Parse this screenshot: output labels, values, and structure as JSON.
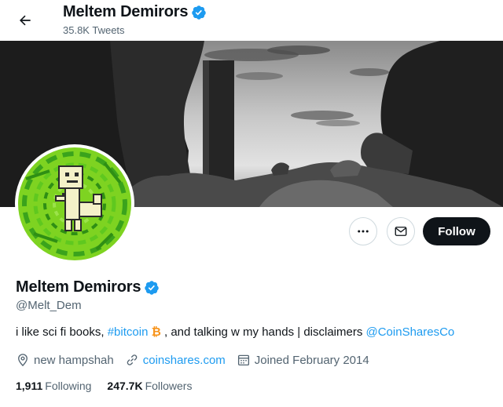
{
  "header": {
    "name": "Meltem Demirors",
    "tweet_count": "35.8K Tweets"
  },
  "icons": {
    "back": "arrow-left-icon",
    "verified": "verified-badge-icon",
    "more": "more-dots-icon",
    "message": "envelope-icon",
    "location": "location-pin-icon",
    "link": "link-icon",
    "joined": "calendar-icon"
  },
  "actions": {
    "follow_label": "Follow"
  },
  "profile": {
    "name": "Meltem Demirors",
    "handle": "@Melt_Dem",
    "bio": {
      "part1": "i like sci fi books, ",
      "hashtag": "#bitcoin",
      "btc_symbol": "₿",
      "part2": " , and talking w my hands | disclaimers ",
      "mention": "@CoinSharesCo"
    },
    "location": "new hampshah",
    "website": "coinshares.com",
    "joined": "Joined February 2014",
    "following_count": "1,911",
    "following_label": "Following",
    "followers_count": "247.7K",
    "followers_label": "Followers"
  },
  "colors": {
    "accent": "#1d9bf0",
    "text": "#0f1419",
    "muted": "#536471",
    "bitcoin": "#f7931a",
    "avatar_green": "#7ed321"
  }
}
